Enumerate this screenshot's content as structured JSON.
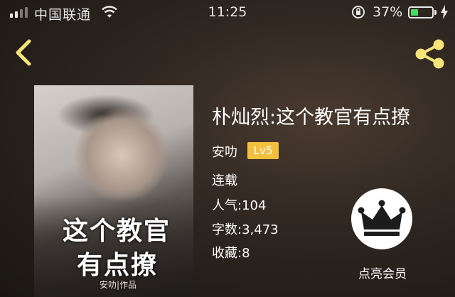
{
  "status_bar": {
    "carrier": "中国联通",
    "time": "11:25",
    "battery_percent": "37%",
    "battery_level": 0.37
  },
  "book": {
    "title": "朴灿烈:这个教官有点撩",
    "author": "安叻",
    "level": "Lv5",
    "status": "连载",
    "popularity_label": "人气:",
    "popularity_value": "104",
    "word_count_label": "字数:",
    "word_count_value": "3,473",
    "favorites_label": "收藏:",
    "favorites_value": "8"
  },
  "cover": {
    "title_line1": "这个教官",
    "title_line2": "有点撩",
    "author_credit": "安叻|作品"
  },
  "actions": {
    "vip_label": "点亮会员"
  },
  "colors": {
    "level_badge": "#f3bf3e",
    "nav_icons": "#f6e47a",
    "battery_fill": "#4cd964"
  },
  "icons": {
    "back": "chevron-left-icon",
    "share": "share-icon",
    "vip": "crown-icon"
  }
}
